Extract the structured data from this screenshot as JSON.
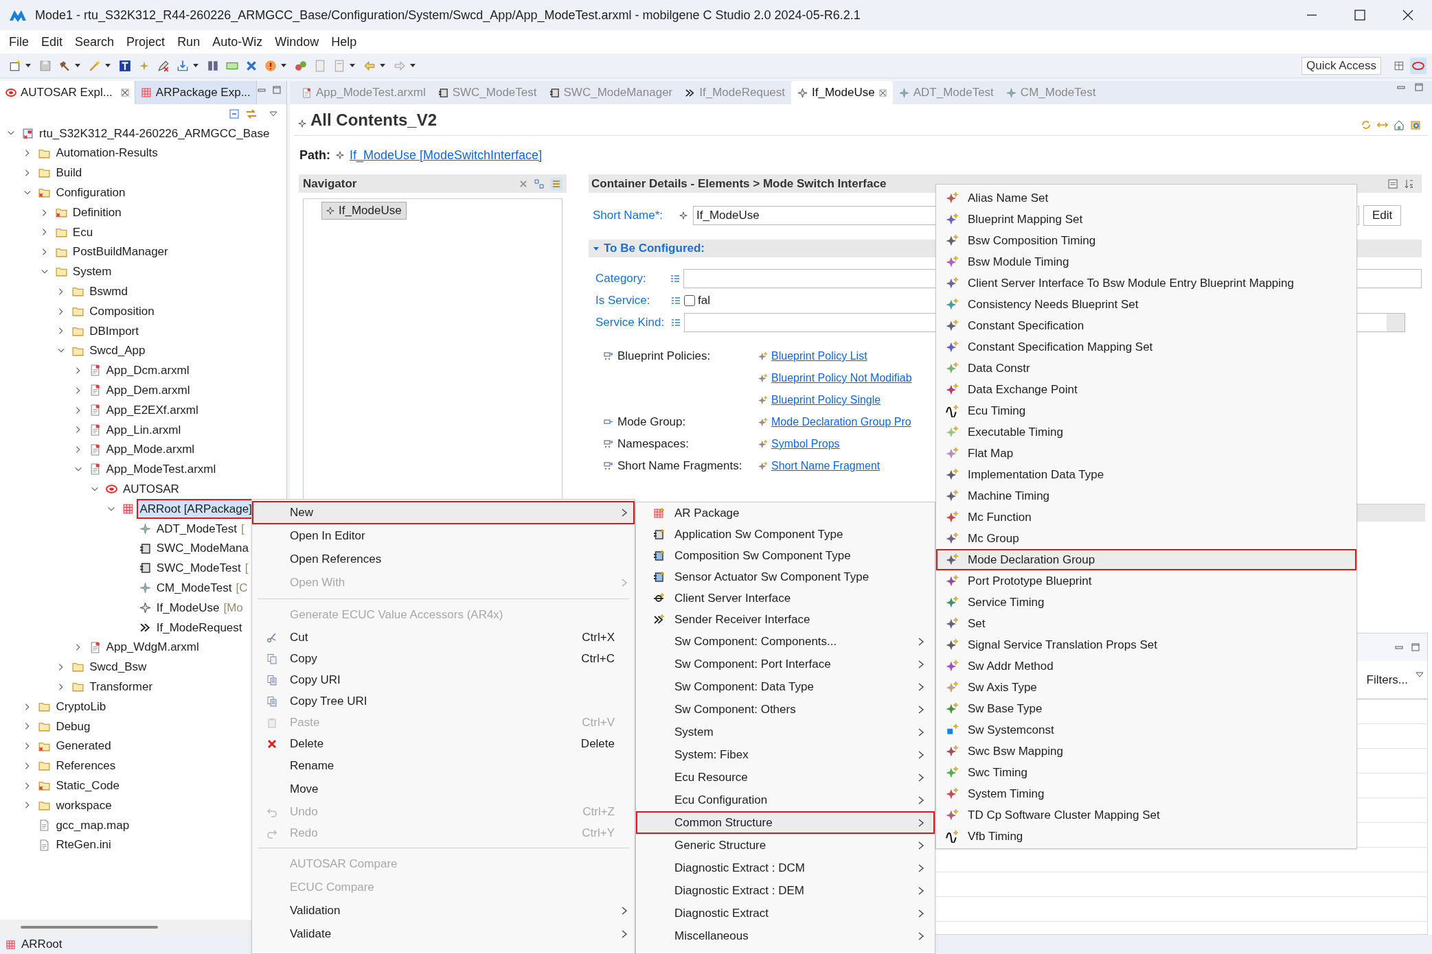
{
  "window": {
    "title": "Mode1 - rtu_S32K312_R44-260226_ARMGCC_Base/Configuration/System/Swcd_App/App_ModeTest.arxml - mobilgene C Studio 2.0 2024-05-R6.2.1"
  },
  "menu_bar": [
    "File",
    "Edit",
    "Search",
    "Project",
    "Run",
    "Auto-Wiz",
    "Window",
    "Help"
  ],
  "toolbar": {
    "quick_access": "Quick Access"
  },
  "explorer": {
    "tabs": [
      {
        "label": "AUTOSAR Expl...",
        "kind": "autosar",
        "selected": true
      },
      {
        "label": "ARPackage Exp...",
        "kind": "package",
        "selected": false
      }
    ],
    "tree": [
      {
        "label": "rtu_S32K312_R44-260226_ARMGCC_Base",
        "kind": "project",
        "expanded": true,
        "highlighted": false,
        "children": [
          {
            "label": "Automation-Results",
            "kind": "folder",
            "expanded": false,
            "highlighted": false
          },
          {
            "label": "Build",
            "kind": "folder",
            "expanded": false,
            "highlighted": false
          },
          {
            "label": "Configuration",
            "kind": "folder_error",
            "expanded": true,
            "highlighted": false,
            "children": [
              {
                "label": "Definition",
                "kind": "folder_error",
                "expanded": false,
                "highlighted": false
              },
              {
                "label": "Ecu",
                "kind": "folder",
                "expanded": false,
                "highlighted": false
              },
              {
                "label": "PostBuildManager",
                "kind": "folder",
                "expanded": false,
                "highlighted": false
              },
              {
                "label": "System",
                "kind": "folder",
                "expanded": true,
                "highlighted": false,
                "children": [
                  {
                    "label": "Bswmd",
                    "kind": "folder",
                    "expanded": false,
                    "highlighted": false
                  },
                  {
                    "label": "Composition",
                    "kind": "folder",
                    "expanded": false,
                    "highlighted": false
                  },
                  {
                    "label": "DBImport",
                    "kind": "folder",
                    "expanded": false,
                    "highlighted": false
                  },
                  {
                    "label": "Swcd_App",
                    "kind": "folder",
                    "expanded": true,
                    "highlighted": false,
                    "children": [
                      {
                        "label": "App_Dcm.arxml",
                        "kind": "arxml",
                        "expanded": false,
                        "highlighted": false
                      },
                      {
                        "label": "App_Dem.arxml",
                        "kind": "arxml",
                        "expanded": false,
                        "highlighted": false
                      },
                      {
                        "label": "App_E2EXf.arxml",
                        "kind": "arxml",
                        "expanded": false,
                        "highlighted": false
                      },
                      {
                        "label": "App_Lin.arxml",
                        "kind": "arxml",
                        "expanded": false,
                        "highlighted": false
                      },
                      {
                        "label": "App_Mode.arxml",
                        "kind": "arxml",
                        "expanded": false,
                        "highlighted": false
                      },
                      {
                        "label": "App_ModeTest.arxml",
                        "kind": "arxml",
                        "expanded": true,
                        "highlighted": false,
                        "children": [
                          {
                            "label": "AUTOSAR",
                            "kind": "autosar",
                            "expanded": true,
                            "highlighted": false,
                            "children": [
                              {
                                "label": "ARRoot [ARPackage]",
                                "kind": "package",
                                "expanded": true,
                                "highlighted": true,
                                "children": [
                                  {
                                    "label": "ADT_ModeTest",
                                    "detail": "[",
                                    "kind": "element",
                                    "highlighted": false
                                  },
                                  {
                                    "label": "SWC_ModeMana",
                                    "kind": "component",
                                    "highlighted": false
                                  },
                                  {
                                    "label": "SWC_ModeTest",
                                    "detail": "[",
                                    "kind": "component",
                                    "highlighted": false
                                  },
                                  {
                                    "label": "CM_ModeTest",
                                    "detail": "[C",
                                    "kind": "element",
                                    "highlighted": false
                                  },
                                  {
                                    "label": "If_ModeUse",
                                    "detail": "[Mo",
                                    "kind": "element_dark",
                                    "highlighted": false
                                  },
                                  {
                                    "label": "If_ModeRequest",
                                    "kind": "sender_receiver",
                                    "highlighted": false
                                  }
                                ]
                              }
                            ]
                          }
                        ]
                      },
                      {
                        "label": "App_WdgM.arxml",
                        "kind": "arxml",
                        "expanded": false,
                        "highlighted": false
                      }
                    ]
                  },
                  {
                    "label": "Swcd_Bsw",
                    "kind": "folder",
                    "expanded": false,
                    "highlighted": false
                  },
                  {
                    "label": "Transformer",
                    "kind": "folder",
                    "expanded": false,
                    "highlighted": false
                  }
                ]
              }
            ]
          },
          {
            "label": "CryptoLib",
            "kind": "folder",
            "expanded": false,
            "highlighted": false
          },
          {
            "label": "Debug",
            "kind": "folder",
            "expanded": false,
            "highlighted": false
          },
          {
            "label": "Generated",
            "kind": "folder_error",
            "expanded": false,
            "highlighted": false
          },
          {
            "label": "References",
            "kind": "folder",
            "expanded": false,
            "highlighted": false
          },
          {
            "label": "Static_Code",
            "kind": "folder_error",
            "expanded": false,
            "highlighted": false
          },
          {
            "label": "workspace",
            "kind": "folder",
            "expanded": false,
            "highlighted": false
          },
          {
            "label": "gcc_map.map",
            "kind": "text_file",
            "highlighted": false
          },
          {
            "label": "RteGen.ini",
            "kind": "text_file",
            "highlighted": false
          }
        ]
      }
    ]
  },
  "editor": {
    "tabs": [
      {
        "label": "App_ModeTest.arxml",
        "kind": "arxml",
        "selected": false
      },
      {
        "label": "SWC_ModeTest",
        "kind": "component",
        "selected": false
      },
      {
        "label": "SWC_ModeManager",
        "kind": "component",
        "selected": false
      },
      {
        "label": "If_ModeRequest",
        "kind": "sender_receiver",
        "selected": false
      },
      {
        "label": "If_ModeUse",
        "kind": "element_dark",
        "selected": true
      },
      {
        "label": "ADT_ModeTest",
        "kind": "element",
        "selected": false
      },
      {
        "label": "CM_ModeTest",
        "kind": "element",
        "selected": false
      }
    ],
    "title": "All Contents_V2",
    "path_label": "Path:",
    "path": "If_ModeUse [ModeSwitchInterface]",
    "navigator": {
      "title": "Navigator",
      "items": [
        "If_ModeUse"
      ]
    },
    "details": {
      "title": "Container Details - Elements > Mode Switch Interface",
      "short_name_label": "Short Name*:",
      "short_name": "If_ModeUse",
      "edit_button": "Edit",
      "section": "To Be Configured:",
      "section_expanded": true,
      "fields": [
        {
          "label": "Category:",
          "kind": "text"
        },
        {
          "label": "Is Service:",
          "kind": "checkbox",
          "checked": false,
          "value": "fal"
        },
        {
          "label": "Service Kind:",
          "kind": "combo"
        }
      ],
      "references": [
        {
          "label": "Blueprint Policies:",
          "kind": "many",
          "links": [
            "Blueprint Policy List",
            "Blueprint Policy Not Modifiab",
            "Blueprint Policy Single"
          ]
        },
        {
          "label": "Mode Group:",
          "kind": "single",
          "links": [
            "Mode Declaration Group Pro"
          ]
        },
        {
          "label": "Namespaces:",
          "kind": "many",
          "links": [
            "Symbol Props"
          ]
        },
        {
          "label": "Short Name Fragments:",
          "kind": "many",
          "links": [
            "Short Name Fragment"
          ]
        }
      ]
    },
    "lower_panel": {
      "filters": "Filters..."
    }
  },
  "context_menu": {
    "groups": [
      {
        "items": [
          {
            "label": "New",
            "kind": "plain",
            "submenu": true,
            "disabled": false,
            "highlighted": true
          },
          {
            "label": "Open In Editor",
            "kind": "plain",
            "submenu": false,
            "disabled": false,
            "highlighted": false
          },
          {
            "label": "Open References",
            "kind": "plain",
            "submenu": false,
            "disabled": false,
            "highlighted": false
          },
          {
            "label": "Open With",
            "kind": "plain",
            "submenu": true,
            "disabled": true,
            "highlighted": false
          }
        ]
      },
      {
        "items": [
          {
            "label": "Generate ECUC Value Accessors (AR4x)",
            "kind": "plain",
            "submenu": false,
            "disabled": true,
            "highlighted": false
          },
          {
            "label": "Cut",
            "kind": "cut",
            "shortcut": "Ctrl+X",
            "submenu": false,
            "disabled": false,
            "highlighted": false
          },
          {
            "label": "Copy",
            "kind": "copy",
            "shortcut": "Ctrl+C",
            "submenu": false,
            "disabled": false,
            "highlighted": false
          },
          {
            "label": "Copy URI",
            "kind": "copy_uri",
            "submenu": false,
            "disabled": false,
            "highlighted": false
          },
          {
            "label": "Copy Tree URI",
            "kind": "copy_uri",
            "submenu": false,
            "disabled": false,
            "highlighted": false
          },
          {
            "label": "Paste",
            "kind": "paste",
            "shortcut": "Ctrl+V",
            "submenu": false,
            "disabled": true,
            "highlighted": false
          },
          {
            "label": "Delete",
            "kind": "delete",
            "shortcut": "Delete",
            "submenu": false,
            "disabled": false,
            "highlighted": false
          },
          {
            "label": "Rename",
            "kind": "plain",
            "submenu": false,
            "disabled": false,
            "highlighted": false
          },
          {
            "label": "Move",
            "kind": "plain",
            "submenu": false,
            "disabled": false,
            "highlighted": false
          },
          {
            "label": "Undo",
            "kind": "undo",
            "shortcut": "Ctrl+Z",
            "submenu": false,
            "disabled": true,
            "highlighted": false
          },
          {
            "label": "Redo",
            "kind": "redo",
            "shortcut": "Ctrl+Y",
            "submenu": false,
            "disabled": true,
            "highlighted": false
          }
        ]
      },
      {
        "items": [
          {
            "label": "AUTOSAR Compare",
            "kind": "plain",
            "submenu": false,
            "disabled": true,
            "highlighted": false
          },
          {
            "label": "ECUC Compare",
            "kind": "plain",
            "submenu": false,
            "disabled": true,
            "highlighted": false
          },
          {
            "label": "Validation",
            "kind": "plain",
            "submenu": true,
            "disabled": false,
            "highlighted": false
          },
          {
            "label": "Validate",
            "kind": "plain",
            "submenu": true,
            "disabled": false,
            "highlighted": false
          }
        ]
      }
    ]
  },
  "new_submenu": {
    "items": [
      {
        "label": "AR Package",
        "kind": "package",
        "submenu": false,
        "highlighted": false
      },
      {
        "label": "Application Sw Component Type",
        "kind": "component",
        "submenu": false,
        "highlighted": false
      },
      {
        "label": "Composition Sw Component Type",
        "kind": "composition",
        "submenu": false,
        "highlighted": false
      },
      {
        "label": "Sensor Actuator Sw Component Type",
        "kind": "composition",
        "submenu": false,
        "highlighted": false
      },
      {
        "label": "Client Server Interface",
        "kind": "client_server",
        "submenu": false,
        "highlighted": false
      },
      {
        "label": "Sender Receiver Interface",
        "kind": "sender_receiver",
        "submenu": false,
        "highlighted": false
      },
      {
        "label": "Sw Component: Components...",
        "kind": "plain",
        "submenu": true,
        "highlighted": false
      },
      {
        "label": "Sw Component: Port Interface",
        "kind": "plain",
        "submenu": true,
        "highlighted": false
      },
      {
        "label": "Sw Component: Data Type",
        "kind": "plain",
        "submenu": true,
        "highlighted": false
      },
      {
        "label": "Sw Component: Others",
        "kind": "plain",
        "submenu": true,
        "highlighted": false
      },
      {
        "label": "System",
        "kind": "plain",
        "submenu": true,
        "highlighted": false
      },
      {
        "label": "System: Fibex",
        "kind": "plain",
        "submenu": true,
        "highlighted": false
      },
      {
        "label": "Ecu Resource",
        "kind": "plain",
        "submenu": true,
        "highlighted": false
      },
      {
        "label": "Ecu Configuration",
        "kind": "plain",
        "submenu": true,
        "highlighted": false
      },
      {
        "label": "Common Structure",
        "kind": "plain",
        "submenu": true,
        "highlighted": true
      },
      {
        "label": "Generic Structure",
        "kind": "plain",
        "submenu": true,
        "highlighted": false
      },
      {
        "label": "Diagnostic Extract : DCM",
        "kind": "plain",
        "submenu": true,
        "highlighted": false
      },
      {
        "label": "Diagnostic Extract : DEM",
        "kind": "plain",
        "submenu": true,
        "highlighted": false
      },
      {
        "label": "Diagnostic Extract",
        "kind": "plain",
        "submenu": true,
        "highlighted": false
      },
      {
        "label": "Miscellaneous",
        "kind": "plain",
        "submenu": true,
        "highlighted": false
      }
    ]
  },
  "common_structure_submenu": {
    "items": [
      {
        "label": "Alias Name Set",
        "kind": "element",
        "color": "#b0605a",
        "highlighted": false
      },
      {
        "label": "Blueprint Mapping Set",
        "kind": "element",
        "color": "#7060b0",
        "highlighted": false
      },
      {
        "label": "Bsw Composition Timing",
        "kind": "element",
        "color": "#606070",
        "highlighted": false
      },
      {
        "label": "Bsw Module Timing",
        "kind": "element",
        "color": "#b060b0",
        "highlighted": false
      },
      {
        "label": "Client Server Interface To Bsw Module Entry Blueprint Mapping",
        "kind": "element",
        "color": "#7060a0",
        "highlighted": false
      },
      {
        "label": "Consistency Needs Blueprint Set",
        "kind": "element",
        "color": "#40a0a0",
        "highlighted": false
      },
      {
        "label": "Constant Specification",
        "kind": "element",
        "color": "#606070",
        "highlighted": false
      },
      {
        "label": "Constant Specification Mapping Set",
        "kind": "element",
        "color": "#6060c0",
        "highlighted": false
      },
      {
        "label": "Data Constr",
        "kind": "element",
        "color": "#80b070",
        "highlighted": false
      },
      {
        "label": "Data Exchange Point",
        "kind": "element",
        "color": "#b04070",
        "highlighted": false
      },
      {
        "label": "Ecu Timing",
        "kind": "timing",
        "highlighted": false
      },
      {
        "label": "Executable Timing",
        "kind": "element",
        "color": "#a0c090",
        "highlighted": false
      },
      {
        "label": "Flat Map",
        "kind": "element",
        "color": "#b090c0",
        "highlighted": false
      },
      {
        "label": "Implementation Data Type",
        "kind": "element",
        "color": "#606070",
        "highlighted": false
      },
      {
        "label": "Machine Timing",
        "kind": "element",
        "color": "#606070",
        "highlighted": false
      },
      {
        "label": "Mc Function",
        "kind": "element",
        "color": "#c05050",
        "highlighted": false
      },
      {
        "label": "Mc Group",
        "kind": "element",
        "color": "#706080",
        "highlighted": false
      },
      {
        "label": "Mode Declaration Group",
        "kind": "element",
        "color": "#606070",
        "highlighted": true
      },
      {
        "label": "Port Prototype Blueprint",
        "kind": "element",
        "color": "#9050a0",
        "highlighted": false
      },
      {
        "label": "Service Timing",
        "kind": "element",
        "color": "#409070",
        "highlighted": false
      },
      {
        "label": "Set",
        "kind": "element",
        "color": "#706080",
        "highlighted": false
      },
      {
        "label": "Signal Service Translation Props Set",
        "kind": "element",
        "color": "#606060",
        "highlighted": false
      },
      {
        "label": "Sw Addr Method",
        "kind": "element",
        "color": "#a050c0",
        "highlighted": false
      },
      {
        "label": "Sw Axis Type",
        "kind": "element",
        "color": "#c0a080",
        "highlighted": false
      },
      {
        "label": "Sw Base Type",
        "kind": "element",
        "color": "#509040",
        "highlighted": false
      },
      {
        "label": "Sw Systemconst",
        "kind": "constant",
        "highlighted": false
      },
      {
        "label": "Swc Bsw Mapping",
        "kind": "element",
        "color": "#a05060",
        "highlighted": false
      },
      {
        "label": "Swc Timing",
        "kind": "element",
        "color": "#50b050",
        "highlighted": false
      },
      {
        "label": "System Timing",
        "kind": "element",
        "color": "#c05060",
        "highlighted": false
      },
      {
        "label": "TD Cp Software Cluster Mapping Set",
        "kind": "element",
        "color": "#b06080",
        "highlighted": false
      },
      {
        "label": "Vfb Timing",
        "kind": "timing",
        "highlighted": false
      }
    ]
  },
  "status_bar": {
    "text": "ARRoot"
  }
}
